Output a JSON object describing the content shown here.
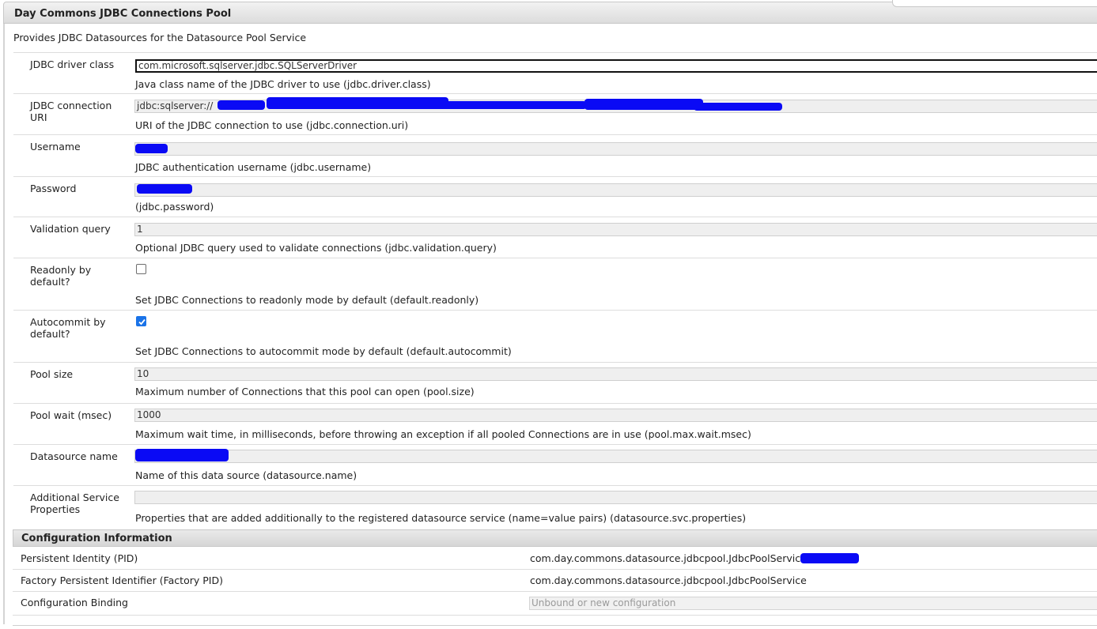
{
  "panel": {
    "title": "Day Commons JDBC Connections Pool",
    "description": "Provides JDBC Datasources for the Datasource Pool Service"
  },
  "fields": [
    {
      "label": "JDBC driver class",
      "value": "com.microsoft.sqlserver.jdbc.SQLServerDriver",
      "help": "Java class name of the JDBC driver to use (jdbc.driver.class)"
    },
    {
      "label": "JDBC connection URI",
      "value": "jdbc:sqlserver://",
      "help": "URI of the JDBC connection to use (jdbc.connection.uri)"
    },
    {
      "label": "Username",
      "value": "",
      "help": "JDBC authentication username (jdbc.username)"
    },
    {
      "label": "Password",
      "value": "",
      "help": "(jdbc.password)"
    },
    {
      "label": "Validation query",
      "value": "1",
      "help": "Optional JDBC query used to validate connections (jdbc.validation.query)"
    },
    {
      "label": "Readonly by default?",
      "checked": false,
      "help": "Set JDBC Connections to readonly mode by default (default.readonly)"
    },
    {
      "label": "Autocommit by default?",
      "checked": true,
      "help": "Set JDBC Connections to autocommit mode by default (default.autocommit)"
    },
    {
      "label": "Pool size",
      "value": "10",
      "help": "Maximum number of Connections that this pool can open (pool.size)"
    },
    {
      "label": "Pool wait (msec)",
      "value": "1000",
      "help": "Maximum wait time, in milliseconds, before throwing an exception if all pooled Connections are in use (pool.max.wait.msec)"
    },
    {
      "label": "Datasource name",
      "value": "",
      "help": "Name of this data source (datasource.name)"
    },
    {
      "label": "Additional Service Properties",
      "value": "",
      "help": "Properties that are added additionally to the registered datasource service (name=value pairs) (datasource.svc.properties)"
    }
  ],
  "config": {
    "title": "Configuration Information",
    "rows": [
      {
        "label": "Persistent Identity (PID)",
        "value": "com.day.commons.datasource.jdbcpool.JdbcPoolService."
      },
      {
        "label": "Factory Persistent Identifier (Factory PID)",
        "value": "com.day.commons.datasource.jdbcpool.JdbcPoolService"
      },
      {
        "label": "Configuration Binding",
        "value": "Unbound or new configuration"
      }
    ]
  },
  "colors": {
    "redaction": "#0a0af5",
    "checkbox_checked": "#1a73e8"
  }
}
